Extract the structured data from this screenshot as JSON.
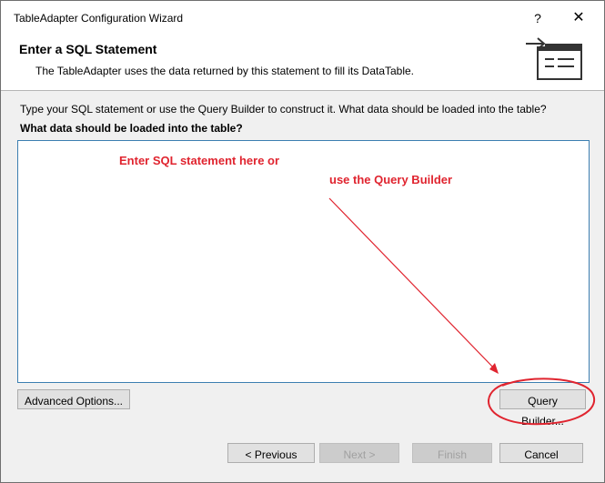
{
  "window": {
    "title": "TableAdapter Configuration Wizard",
    "help_glyph": "?",
    "close_glyph": "✕"
  },
  "header": {
    "title": "Enter a SQL Statement",
    "description": "The TableAdapter uses the data returned by this statement to fill its DataTable."
  },
  "body": {
    "instruction": "Type your SQL statement or use the Query Builder to construct it. What data should be loaded into the table?",
    "question": "What data should be loaded into the table?",
    "sql_value": ""
  },
  "annotations": {
    "line1": "Enter SQL statement here or",
    "line2": "use the Query Builder",
    "color": "#e0242f"
  },
  "buttons": {
    "advanced": "Advanced Options...",
    "query_builder": "Query Builder...",
    "previous": "< Previous",
    "next": "Next >",
    "finish": "Finish",
    "cancel": "Cancel"
  },
  "icons": {
    "help": "help-icon",
    "close": "close-icon",
    "wizard": "wizard-arrow-table-icon",
    "scroll_up": "scroll-up-icon",
    "scroll_down": "scroll-down-icon"
  }
}
